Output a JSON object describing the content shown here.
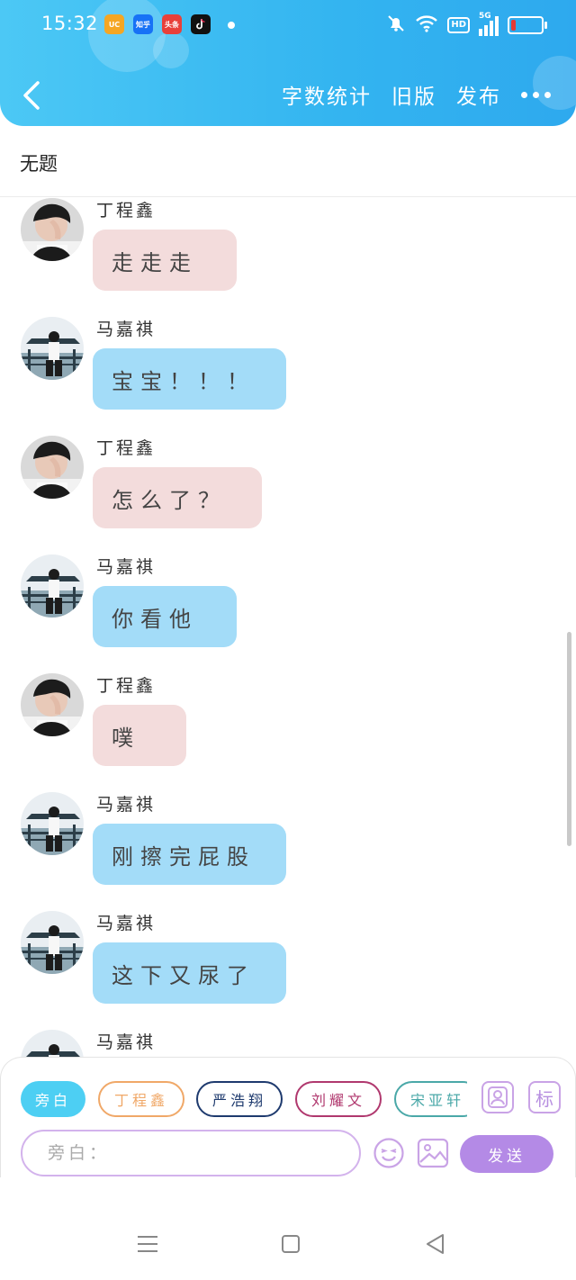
{
  "status_bar": {
    "time": "15:32",
    "apps": [
      "UC",
      "知乎",
      "头条",
      "抖音"
    ],
    "net": "HD",
    "signal": "5G",
    "battery_level": 0.15
  },
  "header": {
    "back_icon": "back-chevron-icon",
    "actions": [
      "字数统计",
      "旧版",
      "发布"
    ],
    "more_icon": "more-dots-icon"
  },
  "document": {
    "title": "无题"
  },
  "messages": [
    {
      "sender": "丁程鑫",
      "text": "走走走",
      "color": "pink"
    },
    {
      "sender": "马嘉祺",
      "text": "宝宝！！！",
      "color": "blue"
    },
    {
      "sender": "丁程鑫",
      "text": "怎么了？",
      "color": "pink"
    },
    {
      "sender": "马嘉祺",
      "text": "你看他",
      "color": "blue"
    },
    {
      "sender": "丁程鑫",
      "text": "噗",
      "color": "pink"
    },
    {
      "sender": "马嘉祺",
      "text": "刚擦完屁股",
      "color": "blue"
    },
    {
      "sender": "马嘉祺",
      "text": "这下又尿了",
      "color": "blue"
    },
    {
      "sender": "马嘉祺",
      "text": "",
      "color": "blue"
    }
  ],
  "role_chips": [
    {
      "label": "旁白",
      "color": "#4dcff3",
      "active": true
    },
    {
      "label": "丁程鑫",
      "color": "#f0a868",
      "active": false
    },
    {
      "label": "严浩翔",
      "color": "#1e3a6e",
      "active": false
    },
    {
      "label": "刘耀文",
      "color": "#b0386e",
      "active": false
    },
    {
      "label": "宋亚轩",
      "color": "#4aa8a8",
      "active": false
    }
  ],
  "tools": {
    "character_icon": "person-card-icon",
    "tag_label": "标"
  },
  "composer": {
    "placeholder": "旁白：",
    "send_label": "发送",
    "emoji_icon": "emoji-icon",
    "image_icon": "image-icon"
  },
  "colors": {
    "header": "#33b4f0",
    "pink_bubble": "#f3dcdc",
    "blue_bubble": "#a3dcf8",
    "accent_purple": "#b48ae6"
  }
}
